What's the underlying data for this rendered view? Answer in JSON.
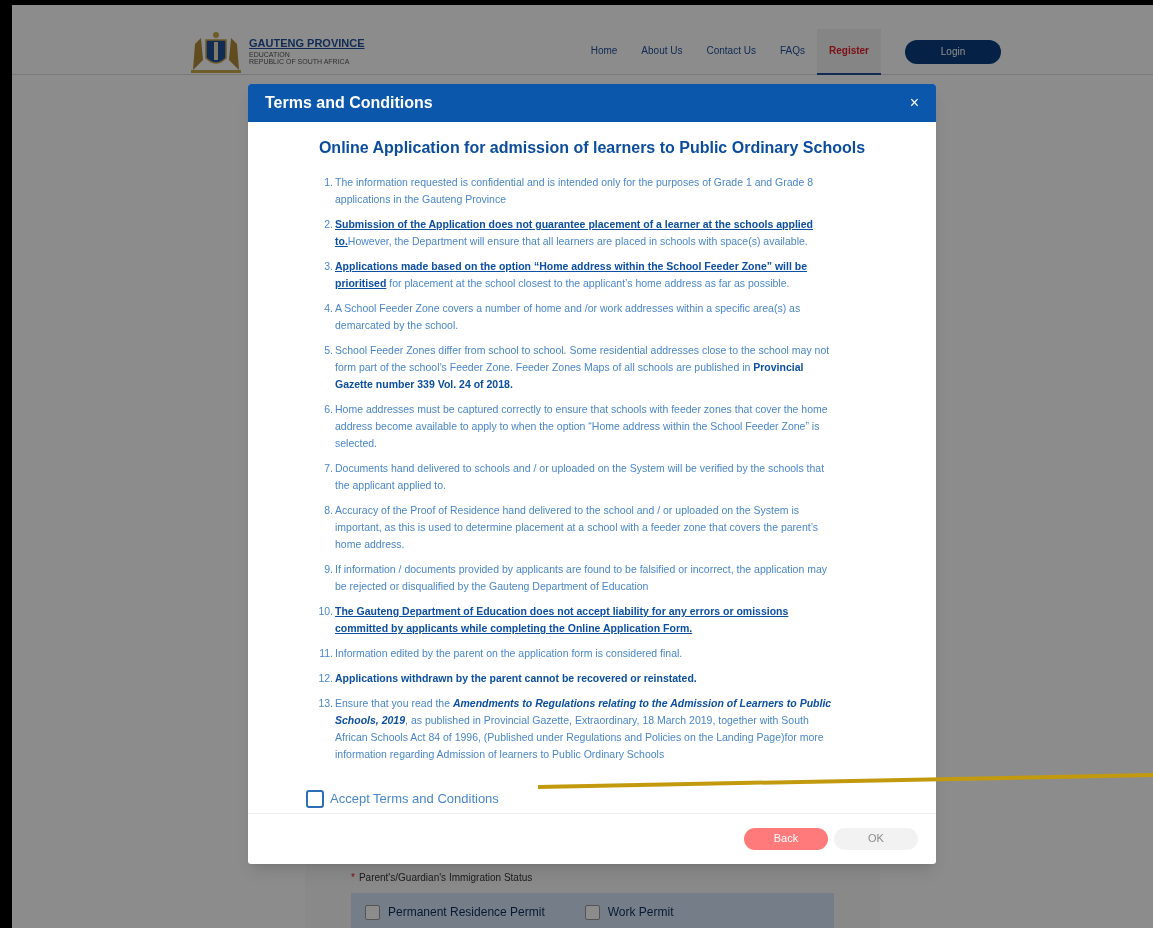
{
  "header": {
    "logo": {
      "title": "GAUTENG PROVINCE",
      "subtitle_1": "EDUCATION",
      "subtitle_2": "REPUBLIC OF SOUTH AFRICA"
    },
    "nav": [
      {
        "label": "Home",
        "selected": false
      },
      {
        "label": "About Us",
        "selected": false
      },
      {
        "label": "Contact Us",
        "selected": false
      },
      {
        "label": "FAQs",
        "selected": false
      },
      {
        "label": "Register",
        "selected": true
      }
    ],
    "login": "Login"
  },
  "form": {
    "required_mark": "*",
    "label": "Parent's/Guardian's Immigration Status",
    "options": [
      {
        "label": "Permanent Residence Permit",
        "checked": false
      },
      {
        "label": "Work Permit",
        "checked": false
      }
    ]
  },
  "modal": {
    "title": "Terms and Conditions",
    "close": "×",
    "heading": "Online Application for admission of learners to Public Ordinary Schools",
    "items": [
      {
        "number": "1.",
        "kind": "plain",
        "text": "The information requested is confidential and is intended only for the purposes of Grade 1 and Grade 8 applications in the Gauteng Province"
      },
      {
        "number": "2.",
        "kind": "underlined",
        "text": "**Submission of the Application does not guarantee placement of a learner at the schools applied to.**However, the Department will ensure that all learners are placed in schools with space(s) available."
      },
      {
        "number": "3.",
        "kind": "underlined",
        "text": "**Applications made based on the option “Home address within the School Feeder Zone” will be prioritised** for placement at the school closest to the applicant’s home address as far as possible."
      },
      {
        "number": "4.",
        "kind": "plain",
        "text": "A School Feeder Zone covers a number of home and /or work addresses within a specific area(s) as demarcated by the school."
      },
      {
        "number": "5.",
        "kind": "plain",
        "text": "School Feeder Zones differ from school to school. Some residential addresses close to the school may not form part of the school’s Feeder Zone. Feeder Zones Maps of all schools are published in **Provincial Gazette number 339 Vol. 24 of 2018.**"
      },
      {
        "number": "6.",
        "kind": "plain",
        "text": "Home addresses must be captured correctly to ensure that schools with feeder zones that cover the home address become available to apply to when the option “Home address within the School Feeder Zone” is selected."
      },
      {
        "number": "7.",
        "kind": "plain",
        "text": "Documents hand delivered to schools and / or uploaded on the System will be verified by the schools that the applicant applied to."
      },
      {
        "number": "8.",
        "kind": "plain",
        "text": "Accuracy of the Proof of Residence hand delivered to the school and / or uploaded on the System is important, as this is used to determine placement at a school with a feeder zone that covers the parent’s home address."
      },
      {
        "number": "9.",
        "kind": "plain",
        "text": "If information / documents provided by applicants are found to be falsified or incorrect, the application may be rejected or disqualified by the Gauteng Department of Education"
      },
      {
        "number": "10.",
        "kind": "underlined",
        "text": "**The Gauteng Department of Education does not accept liability for any errors or omissions committed by applicants while completing the Online Application Form.**"
      },
      {
        "number": "11.",
        "kind": "plain",
        "text": "Information edited by the parent on the application form is considered final."
      },
      {
        "number": "12.",
        "kind": "plain",
        "text": "**Applications withdrawn by the parent cannot be recovered or reinstated.**"
      },
      {
        "number": "13.",
        "kind": "italic",
        "text": "Ensure that you read the **Amendments to Regulations relating to the Admission of Learners to Public Schools, 2019**, as published in Provincial Gazette, Extraordinary, 18 March 2019, together with South African Schools Act 84 of 1996, (Published under Regulations and Policies on the Landing Page)for more information regarding Admission of learners to Public Ordinary Schools"
      }
    ],
    "accept": {
      "label": "Accept Terms and Conditions",
      "checked": false
    },
    "buttons": [
      {
        "label": "Back",
        "disabled": false
      },
      {
        "label": "OK",
        "disabled": true
      }
    ]
  }
}
